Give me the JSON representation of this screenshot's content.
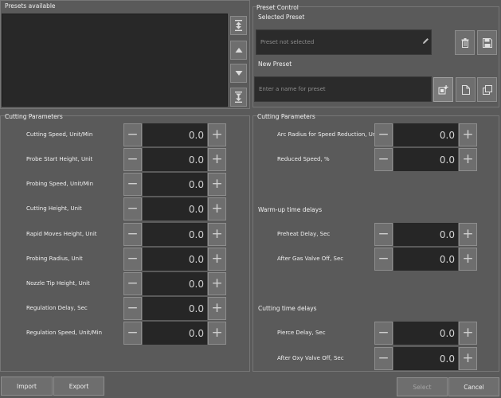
{
  "presets": {
    "title": "Presets available"
  },
  "preset_control": {
    "title": "Preset Control",
    "selected_label": "Selected Preset",
    "selected_value": "Preset not selected",
    "new_label": "New Preset",
    "new_placeholder": "Enter a name for preset"
  },
  "left_params": {
    "title": "Cutting Parameters",
    "rows": [
      {
        "label": "Cutting Speed, Unit/Min",
        "value": "0.0"
      },
      {
        "label": "Probe Start Height, Unit",
        "value": "0.0"
      },
      {
        "label": "Probing Speed, Unit/Min",
        "value": "0.0"
      },
      {
        "label": "Cutting Height, Unit",
        "value": "0.0"
      },
      {
        "label": "Rapid Moves Height, Unit",
        "value": "0.0"
      },
      {
        "label": "Probing Radius, Unit",
        "value": "0.0"
      },
      {
        "label": "Nozzle Tip Height, Unit",
        "value": "0.0"
      },
      {
        "label": "Regulation Delay, Sec",
        "value": "0.0"
      },
      {
        "label": "Regulation Speed, Unit/Min",
        "value": "0.0"
      }
    ]
  },
  "right_params": {
    "title": "Cutting Parameters",
    "arc_label": "Arc Radius for Speed Reduction, Unit",
    "arc_value": "0.0",
    "reduced_label": "Reduced Speed, %",
    "reduced_value": "0.0",
    "warmup_title": "Warm-up time delays",
    "preheat_label": "Preheat Delay, Sec",
    "preheat_value": "0.0",
    "gasoff_label": "After Gas Valve Off, Sec",
    "gasoff_value": "0.0",
    "cutting_title": "Cutting time delays",
    "pierce_label": "Pierce Delay, Sec",
    "pierce_value": "0.0",
    "oxyoff_label": "After Oxy Valve Off, Sec",
    "oxyoff_value": "0.0"
  },
  "footer": {
    "import": "Import",
    "export": "Export",
    "select": "Select",
    "cancel": "Cancel"
  },
  "icons": {
    "scroll_top": "scroll-top-icon",
    "scroll_up": "scroll-up-icon",
    "scroll_down": "scroll-down-icon",
    "scroll_bottom": "scroll-bottom-icon",
    "delete": "trash-icon",
    "save": "save-icon",
    "edit": "pencil-icon",
    "add": "add-preset-icon",
    "new": "new-file-icon",
    "copy": "copy-icon"
  },
  "stepper": {
    "minus": "−",
    "plus": "+"
  }
}
